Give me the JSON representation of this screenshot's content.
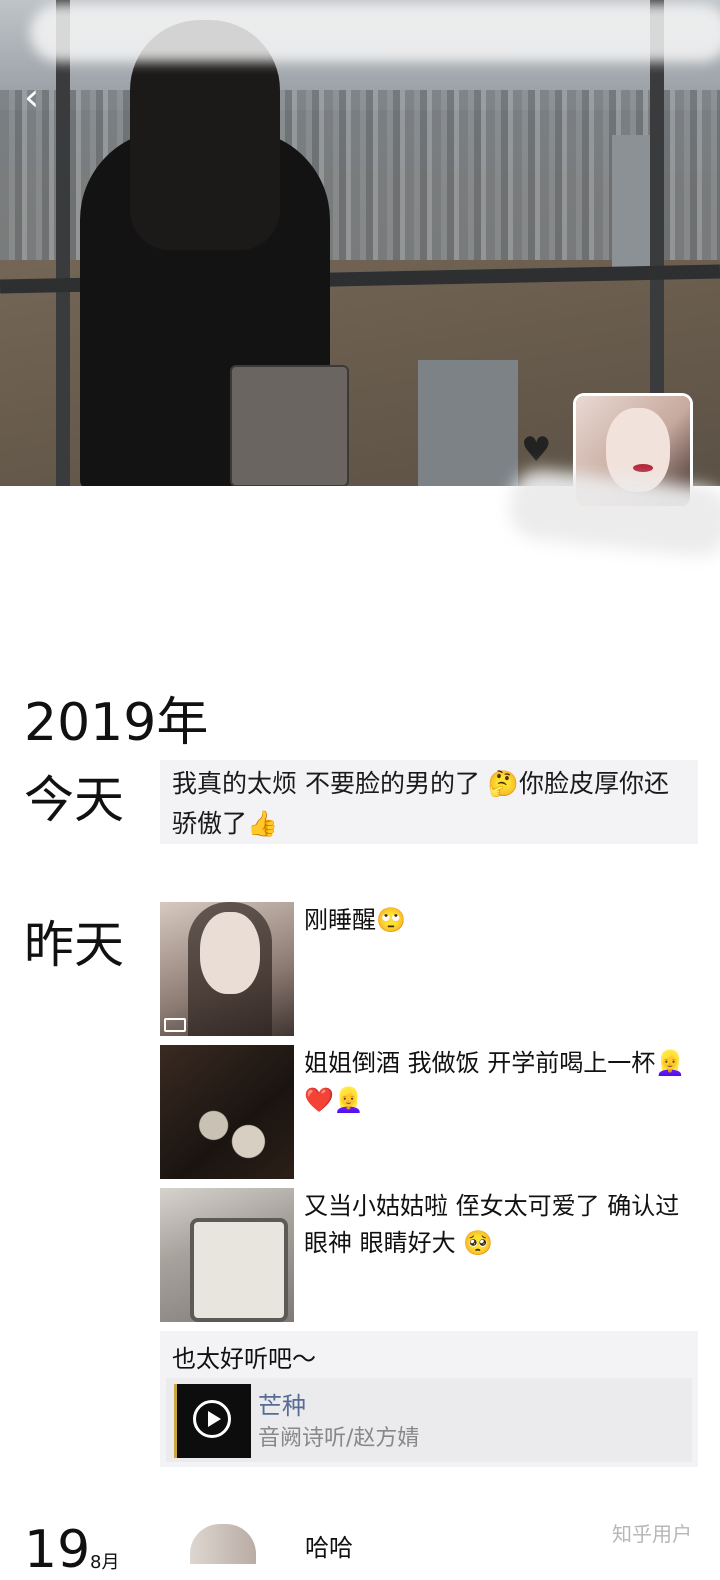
{
  "year": "2019年",
  "today": {
    "label": "今天",
    "text": "我真的太烦 不要脸的男的了 🤔你脸皮厚你还骄傲了👍"
  },
  "yesterday": {
    "label": "昨天",
    "posts": [
      {
        "text": "刚睡醒🙄",
        "thumb": "selfie-video-thumbnail"
      },
      {
        "text": "姐姐倒酒 我做饭 开学前喝上一杯👱‍♀️❤️👱‍♀️",
        "thumb": "drinks-photo"
      },
      {
        "text": "又当小姑姑啦 侄女太可爱了 确认过眼神 眼睛好大 🥺",
        "thumb": "baby-crib-photo"
      }
    ],
    "music_post": {
      "caption": "也太好听吧～",
      "title": "芒种",
      "artist": "音阙诗听/赵方婧"
    }
  },
  "next": {
    "day": "19",
    "month_suffix": "8月",
    "text": "哈哈"
  },
  "watermark": "知乎用户",
  "icons": {
    "back": "chevron-left-icon",
    "video": "video-camera-icon",
    "play": "play-icon",
    "heart": "heart-icon"
  }
}
